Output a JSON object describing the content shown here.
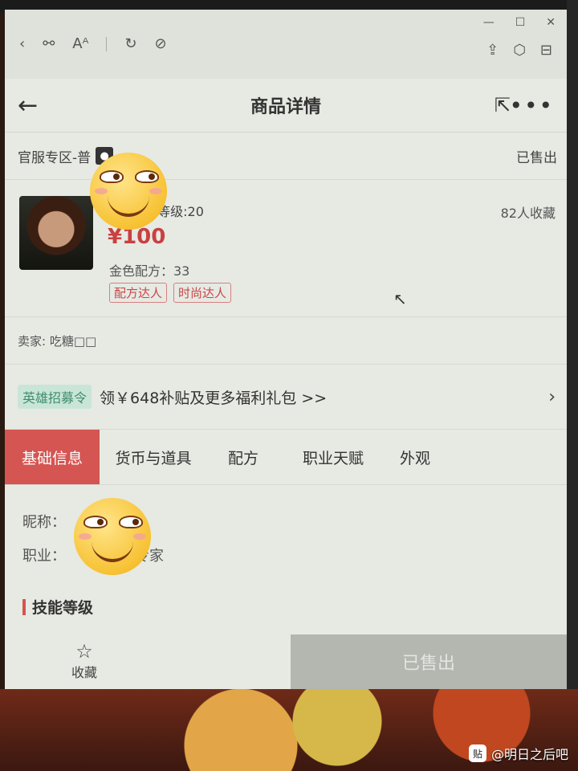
{
  "header": {
    "title": "商品详情",
    "back_icon": "back-arrow-icon",
    "share_icon": "share-icon",
    "more_icon": "more-icon"
  },
  "zone": {
    "label": "官服专区-普",
    "platform_icon": "apple-icon",
    "status": "已售出"
  },
  "product": {
    "name_suffix": "□",
    "manor_level": "庄园等级:20",
    "favorites": "82人收藏",
    "price": "¥100",
    "gold_recipe": "金色配方：33",
    "tags": [
      "配方达人",
      "时尚达人"
    ]
  },
  "seller": {
    "label": "卖家: 吃糖□□"
  },
  "promo": {
    "badge": "英雄招募令",
    "text": "领￥648补贴及更多福利礼包 >>"
  },
  "tabs": [
    {
      "label": "基础信息",
      "active": true
    },
    {
      "label": "货币与道具",
      "active": false
    },
    {
      "label": "配方",
      "active": false
    },
    {
      "label": "职业天赋",
      "active": false
    },
    {
      "label": "外观",
      "active": false
    }
  ],
  "basic_info": {
    "nickname_label": "昵称：",
    "job_label": "职业：",
    "job_value_suffix": "专家"
  },
  "section": {
    "title": "技能等级"
  },
  "bottom": {
    "favorite_label": "收藏",
    "buy_label": "已售出"
  },
  "watermark": {
    "text": "@明日之后吧",
    "icon_label": "贴"
  },
  "colors": {
    "accent": "#d45552",
    "price": "#c94040",
    "promo_badge_bg": "#c9e5d8",
    "disabled_button": "#b4b6b0"
  }
}
